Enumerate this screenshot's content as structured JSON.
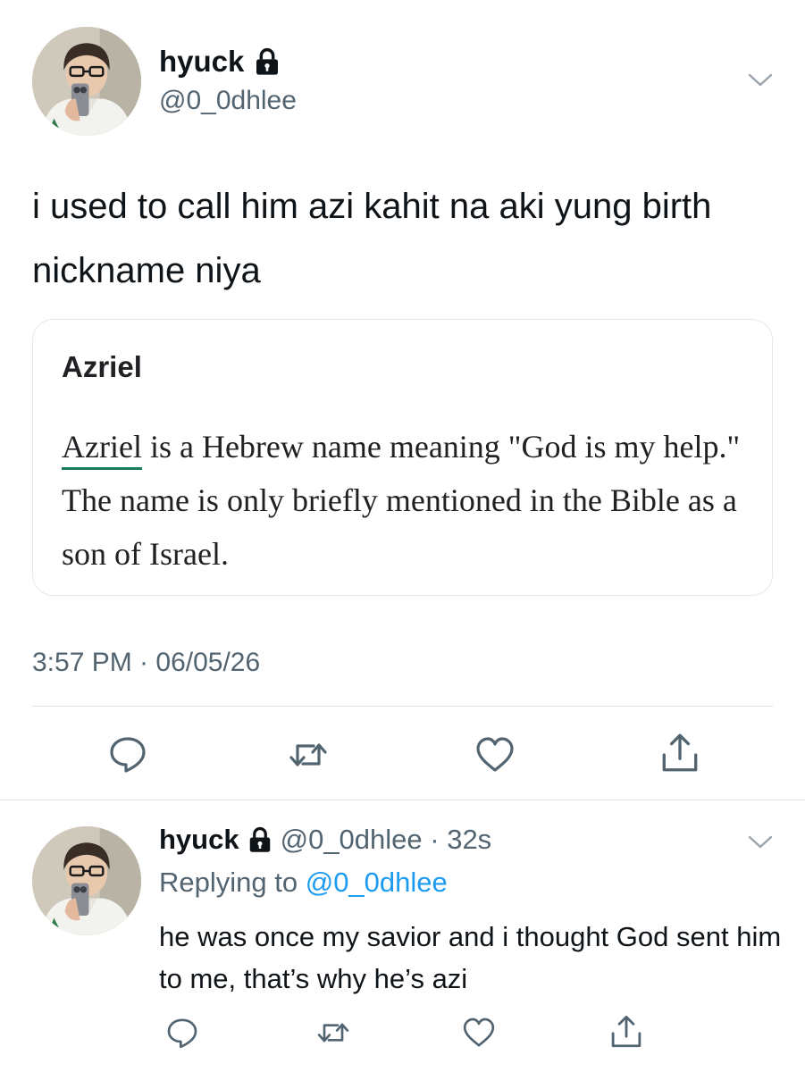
{
  "main_tweet": {
    "display_name": "hyuck",
    "handle": "@0_0dhlee",
    "text": "i used to call him azi kahit na aki yung birth nickname niya",
    "timestamp": "3:57 PM · 06/05/26",
    "lock_icon": "lock-icon",
    "menu_icon": "chevron-down-icon"
  },
  "card": {
    "title": "Azriel",
    "link_word": "Azriel",
    "body": " is a Hebrew name meaning \"God is my help.\" The name is only briefly mentioned in the Bible as a son of Israel."
  },
  "actions": [
    "reply-icon",
    "retweet-icon",
    "like-icon",
    "share-icon"
  ],
  "reply_tweet": {
    "display_name": "hyuck",
    "meta": "@0_0dhlee · 32s",
    "replying_label": "Replying to ",
    "replying_handle": "@0_0dhlee",
    "text": "he was once my savior and i thought God sent him to me, that’s why he’s azi"
  },
  "colors": {
    "text": "#0f1419",
    "secondary": "#536471",
    "link": "#1d9bf0",
    "card_border": "#e1e8ed",
    "card_underline": "#1a7a5c"
  }
}
